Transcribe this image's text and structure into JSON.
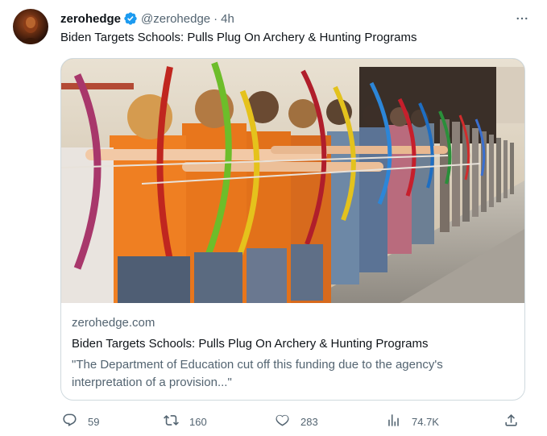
{
  "tweet": {
    "display_name": "zerohedge",
    "handle": "@zerohedge",
    "separator": "·",
    "time": "4h",
    "text": "Biden Targets Schools: Pulls Plug On Archery & Hunting Programs"
  },
  "card": {
    "domain": "zerohedge.com",
    "title": "Biden Targets Schools: Pulls Plug On Archery & Hunting Programs",
    "description": "\"The Department of Education cut off this funding due to the agency's interpretation of a provision...\""
  },
  "actions": {
    "replies": "59",
    "reposts": "160",
    "likes": "283",
    "views": "74.7K"
  },
  "colors": {
    "verified": "#1d9bf0",
    "muted": "#536471",
    "border": "#cfd9de"
  }
}
